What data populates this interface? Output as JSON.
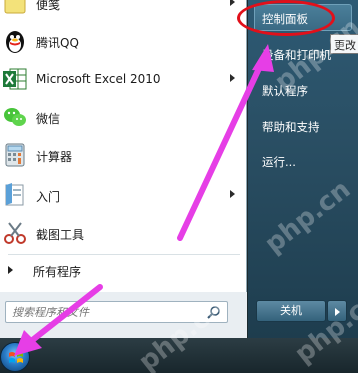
{
  "start_menu": {
    "programs": [
      {
        "label": "便笺",
        "icon": "sticky-notes-icon",
        "submenu": true
      },
      {
        "label": "腾讯QQ",
        "icon": "qq-penguin-icon",
        "submenu": false
      },
      {
        "label": "Microsoft Excel 2010",
        "icon": "excel-icon",
        "submenu": true
      },
      {
        "label": "微信",
        "icon": "wechat-icon",
        "submenu": false
      },
      {
        "label": "计算器",
        "icon": "calculator-icon",
        "submenu": false
      },
      {
        "label": "入门",
        "icon": "getting-started-icon",
        "submenu": true
      },
      {
        "label": "截图工具",
        "icon": "snipping-tool-icon",
        "submenu": false
      }
    ],
    "all_programs": "所有程序",
    "search_placeholder": "搜索程序和文件",
    "right_items": [
      "控制面板",
      "设备和打印机",
      "默认程序",
      "帮助和支持",
      "运行..."
    ],
    "tooltip": "更改",
    "shutdown_label": "关机",
    "watermark": "php.cn",
    "colors": {
      "highlight_ellipse": "#e1101a",
      "annotation_arrow": "#e63ee6",
      "right_panel": "#2d5a74"
    }
  }
}
